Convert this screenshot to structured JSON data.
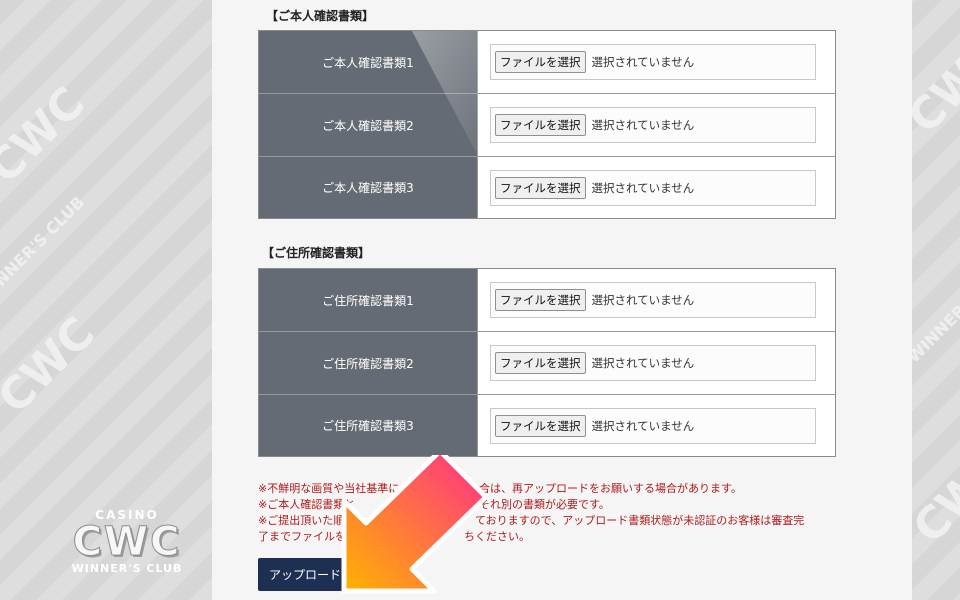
{
  "watermark": {
    "casino": "CASINO",
    "brand": "CWC",
    "club": "WINNER'S CLUB"
  },
  "identity_section": {
    "title": "【ご本人確認書類】",
    "rows": [
      {
        "label": "ご本人確認書類1",
        "button": "ファイルを選択",
        "status": "選択されていません"
      },
      {
        "label": "ご本人確認書類2",
        "button": "ファイルを選択",
        "status": "選択されていません"
      },
      {
        "label": "ご本人確認書類3",
        "button": "ファイルを選択",
        "status": "選択されていません"
      }
    ]
  },
  "address_section": {
    "title": "【ご住所確認書類】",
    "rows": [
      {
        "label": "ご住所確認書類1",
        "button": "ファイルを選択",
        "status": "選択されていません"
      },
      {
        "label": "ご住所確認書類2",
        "button": "ファイルを選択",
        "status": "選択されていません"
      },
      {
        "label": "ご住所確認書類3",
        "button": "ファイルを選択",
        "status": "選択されていません"
      }
    ]
  },
  "notes": [
    "※不鮮明な画質や当社基準に",
    "合は、再アップロードをお願いする場合があります。",
    "※ご本人確認書類と",
    "それ別の書類が必要です。",
    "※ご提出頂いた順に",
    "ておりますので、アップロード書類状態が未認証のお客様は審査完",
    "了までファイルを",
    "ちください。"
  ],
  "upload_button": "アップロード",
  "colors": {
    "label_bg": "#656b74",
    "note_text": "#b01a1a",
    "upload_bg": "#1d2f52",
    "arrow_start": "#ff2e8a",
    "arrow_end": "#ffb300"
  }
}
